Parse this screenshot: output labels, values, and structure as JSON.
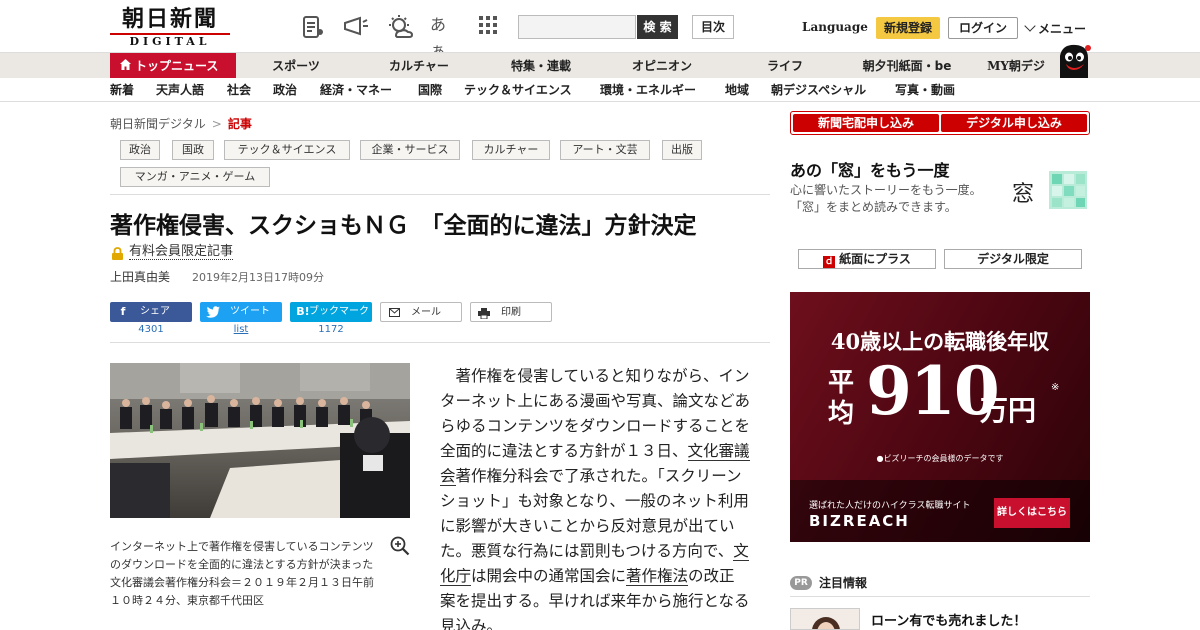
{
  "header": {
    "logo_main": "朝日新聞",
    "logo_sub": "DIGITAL",
    "search_button": "検 索",
    "search_placeholder": "",
    "toc_button": "目次",
    "language": "Language",
    "register": "新規登録",
    "login": "ログイン",
    "menu": "メニュー",
    "icons": [
      "paper-icon",
      "megaphone-icon",
      "weather-icon",
      "font-size-icon",
      "grid-icon"
    ],
    "font_size_glyph": "あぁ"
  },
  "nav_primary": {
    "active": "トップニュース",
    "items": [
      "スポーツ",
      "カルチャー",
      "特集・連載",
      "オピニオン",
      "ライフ",
      "朝夕刊紙面・be",
      "MY朝デジ"
    ]
  },
  "nav_secondary": [
    "新着",
    "天声人語",
    "社会",
    "政治",
    "経済・マネー",
    "国際",
    "テック＆サイエンス",
    "環境・エネルギー",
    "地域",
    "朝デジスペシャル",
    "写真・動画"
  ],
  "breadcrumb": {
    "home": "朝日新聞デジタル",
    "separator": ">",
    "current": "記事"
  },
  "tags": [
    "政治",
    "国政",
    "テック＆サイエンス",
    "企業・サービス",
    "カルチャー",
    "アート・文芸",
    "出版",
    "マンガ・アニメ・ゲーム"
  ],
  "article": {
    "headline": "著作権侵害、スクショもＮＧ　「全面的に違法」方針決定",
    "member_label": "有料会員限定記事",
    "author": "上田真由美",
    "date": "2019年2月13日17時09分",
    "share": [
      {
        "label": "シェア",
        "count": "4301",
        "color": "#3b5998",
        "icon": "facebook-icon",
        "glyph": "f"
      },
      {
        "label": "ツイート",
        "count": "list",
        "color": "#1da1f2",
        "icon": "twitter-icon",
        "glyph": "t"
      },
      {
        "label": "ブックマーク",
        "count": "1172",
        "color": "#00a4de",
        "icon": "hatena-bookmark-icon",
        "glyph": "B!"
      },
      {
        "label": "メール",
        "icon": "mail-icon"
      },
      {
        "label": "印刷",
        "icon": "print-icon"
      }
    ],
    "photo_caption": "インターネット上で著作権を侵害しているコンテンツのダウンロードを全面的に違法とする方針が決まった文化審議会著作権分科会＝２０１９年２月１３日午前１０時２４分、東京都千代田区",
    "body": {
      "p1": "　著作権を侵害していると知りながら、インターネット上にある漫画や写真、論文などあらゆるコンテンツをダウンロードすることを全面的に違法とする方針が１３日、",
      "link1": "文化審議会",
      "p2": "著作権分科会で了承された。「スクリーンショット」も対象となり、一般のネット利用に影響が大きいことから反対意見が出ていた。悪質な行為には罰則もつける方向で、",
      "link2": "文化庁",
      "p3": "は開会中の通常国会に",
      "link3": "著作権法",
      "p4": "の改正案を提出する。早ければ来年から施行となる見込み。"
    }
  },
  "sidebar": {
    "subscribe_delivery": "新聞宅配申し込み",
    "subscribe_digital": "デジタル申し込み",
    "mado_title": "あの「窓」をもう一度",
    "mado_desc": "心に響いたストーリーをもう一度。「窓」をまとめ読みできます。",
    "mado_logo_glyph": "窓",
    "plus_paper": "紙面にプラス",
    "plus_paper_icon_glyph": "ｄ",
    "digital_only": "デジタル限定",
    "ad": {
      "title": "40歳以上の転職後年収",
      "avg": "平均",
      "number": "910",
      "unit": "万円",
      "asterisk": "※",
      "note": "●ビズリーチの会員様のデータです",
      "tagline": "選ばれた人だけのハイクラス転職サイト",
      "brand": "BIZREACH",
      "cta": "詳しくはこちら"
    },
    "pr_badge": "PR",
    "pr_title": "注目情報",
    "pr_item": "ローン有でも売れました！"
  },
  "colors": {
    "brand_red": "#c8102e",
    "nav_bg": "#ebe8e3",
    "register_yellow": "#f5c842"
  }
}
